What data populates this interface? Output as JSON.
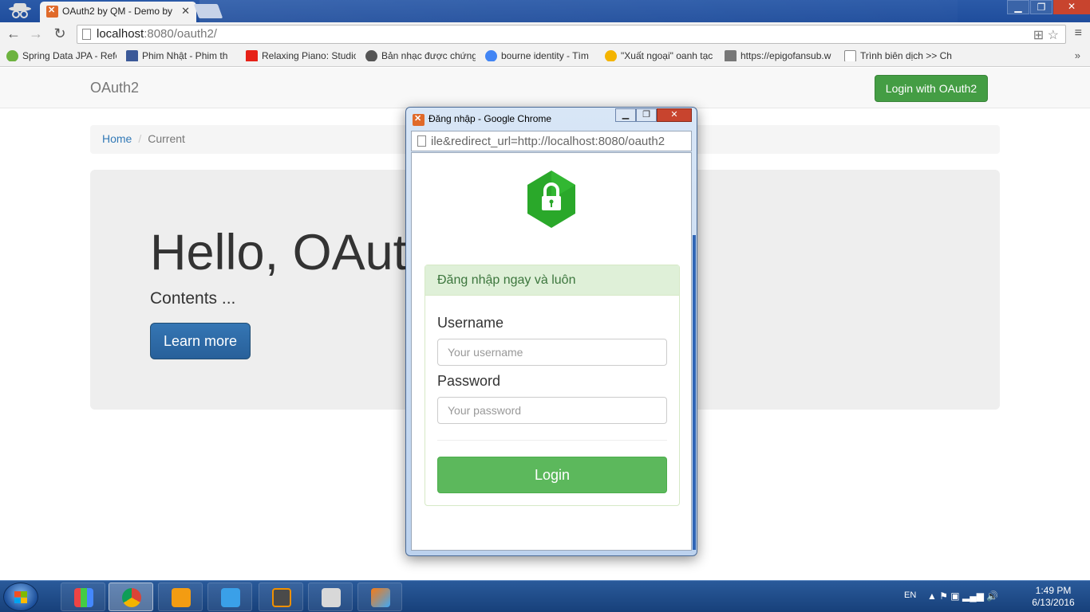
{
  "browser": {
    "tab_title": "OAuth2 by QM - Demo by",
    "url_host": "localhost",
    "url_path": ":8080/oauth2/",
    "bookmarks": [
      {
        "label": "Spring Data JPA - Refe",
        "color": "#6db33f"
      },
      {
        "label": "Phim Nhật  - Phim th",
        "color": "#3b5998"
      },
      {
        "label": "Relaxing Piano: Studio",
        "color": "#e62117"
      },
      {
        "label": "Bản nhạc được chứng",
        "color": "#555555"
      },
      {
        "label": "bourne identity - Tìm",
        "color": "#4285f4"
      },
      {
        "label": "\"Xuất ngoại\" oanh tạc",
        "color": "#f4b400"
      },
      {
        "label": "https://epigofansub.w",
        "color": "#777777"
      },
      {
        "label": "Trình biên dịch >> Ch",
        "color": "#888888"
      }
    ]
  },
  "page": {
    "brand": "OAuth2",
    "login_button": "Login with OAuth2",
    "breadcrumb": {
      "home": "Home",
      "separator": "/",
      "current": "Current"
    },
    "jumbotron": {
      "heading": "Hello, OAuth2",
      "text": "Contents ...",
      "button": "Learn more"
    }
  },
  "popup": {
    "window_title": "Đăng nhập - Google Chrome",
    "url": "ile&redirect_url=http://localhost:8080/oauth2",
    "panel_heading": "Đăng nhập ngay và luôn",
    "username_label": "Username",
    "username_placeholder": "Your username",
    "password_label": "Password",
    "password_placeholder": "Your password",
    "login_button": "Login",
    "lock_color": "#2aa82a"
  },
  "taskbar": {
    "language": "EN",
    "time": "1:49 PM",
    "date": "6/13/2016",
    "apps": [
      "start-menu-icon",
      "apps-grid-icon",
      "chrome-icon",
      "media-player-icon",
      "upload-icon",
      "sublime-text-icon",
      "file-manager-icon",
      "intellij-icon"
    ]
  }
}
